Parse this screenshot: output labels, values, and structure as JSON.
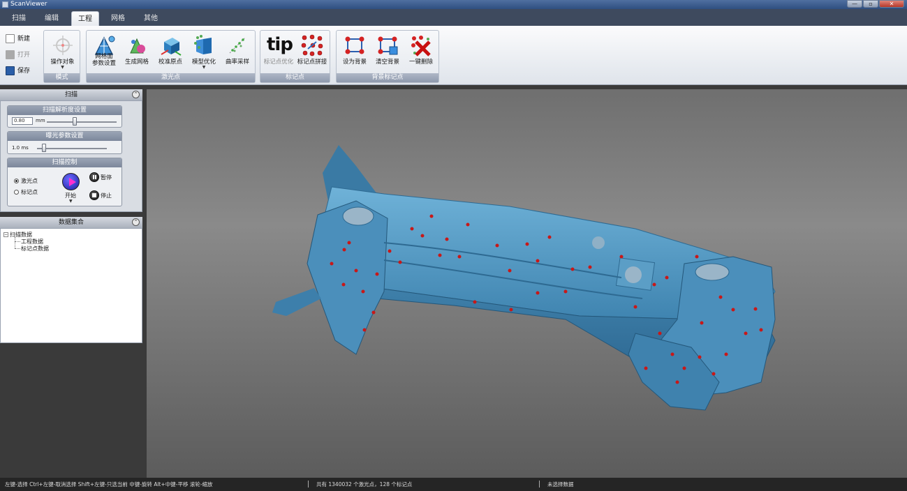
{
  "window": {
    "title": "ScanViewer",
    "minimize": "—",
    "maximize": "▫",
    "close": "✕"
  },
  "menu": {
    "tabs": [
      {
        "label": "扫描"
      },
      {
        "label": "编辑"
      },
      {
        "label": "工程"
      },
      {
        "label": "网格"
      },
      {
        "label": "其他"
      }
    ],
    "active_tab": "工程"
  },
  "ribbon": {
    "quick": {
      "new": "新建",
      "open": "打开",
      "save": "保存"
    },
    "groups": {
      "mode": {
        "label": "模式",
        "operate_object": "操作对象"
      },
      "laser": {
        "label": "激光点",
        "mesh_params_line1": "网格面",
        "mesh_params_line2": "参数设置",
        "generate_mesh": "生成网格",
        "calibrate_origin": "校准原点",
        "model_optimize": "模型优化",
        "curvature_sampling": "曲率采样"
      },
      "markers": {
        "label": "标记点",
        "tip_text": "tip",
        "marker_optimize": "标记点优化",
        "marker_stitch": "标记点拼接"
      },
      "background": {
        "label": "背景标记点",
        "set_background": "设为背景",
        "clear_background": "清空背景",
        "one_click_delete": "一键删除"
      }
    }
  },
  "scan_panel": {
    "title": "扫描",
    "collapse_icon": "⌃",
    "resolution": {
      "title": "扫描解析度设置",
      "value": "0.80",
      "unit": "mm",
      "level": 0.4
    },
    "exposure": {
      "title": "曝光参数设置",
      "value": "1.0 ms",
      "level": 0.1
    },
    "control": {
      "title": "扫描控制",
      "laser_points": "激光点",
      "marker_points": "标记点",
      "selected_mode": "激光点",
      "start": "开始",
      "pause": "暂停",
      "stop": "停止"
    }
  },
  "data_panel": {
    "title": "数据集合",
    "tree": {
      "root": "扫描数据",
      "toggle": "−",
      "children": [
        "工程数据",
        "标记点数据"
      ]
    }
  },
  "status": {
    "hint": "左键-选择 Ctrl+左键-取消选择 Shift+左键-只选当前 中键-旋转 Alt+中键-平移 滚轮-缩放",
    "counts": "共有 1340032 个激光点，128 个标记点",
    "selection": "未选择数据"
  },
  "colors": {
    "model": "#4a8fb8",
    "marker": "#c81818",
    "accent": "#2f4f80"
  }
}
